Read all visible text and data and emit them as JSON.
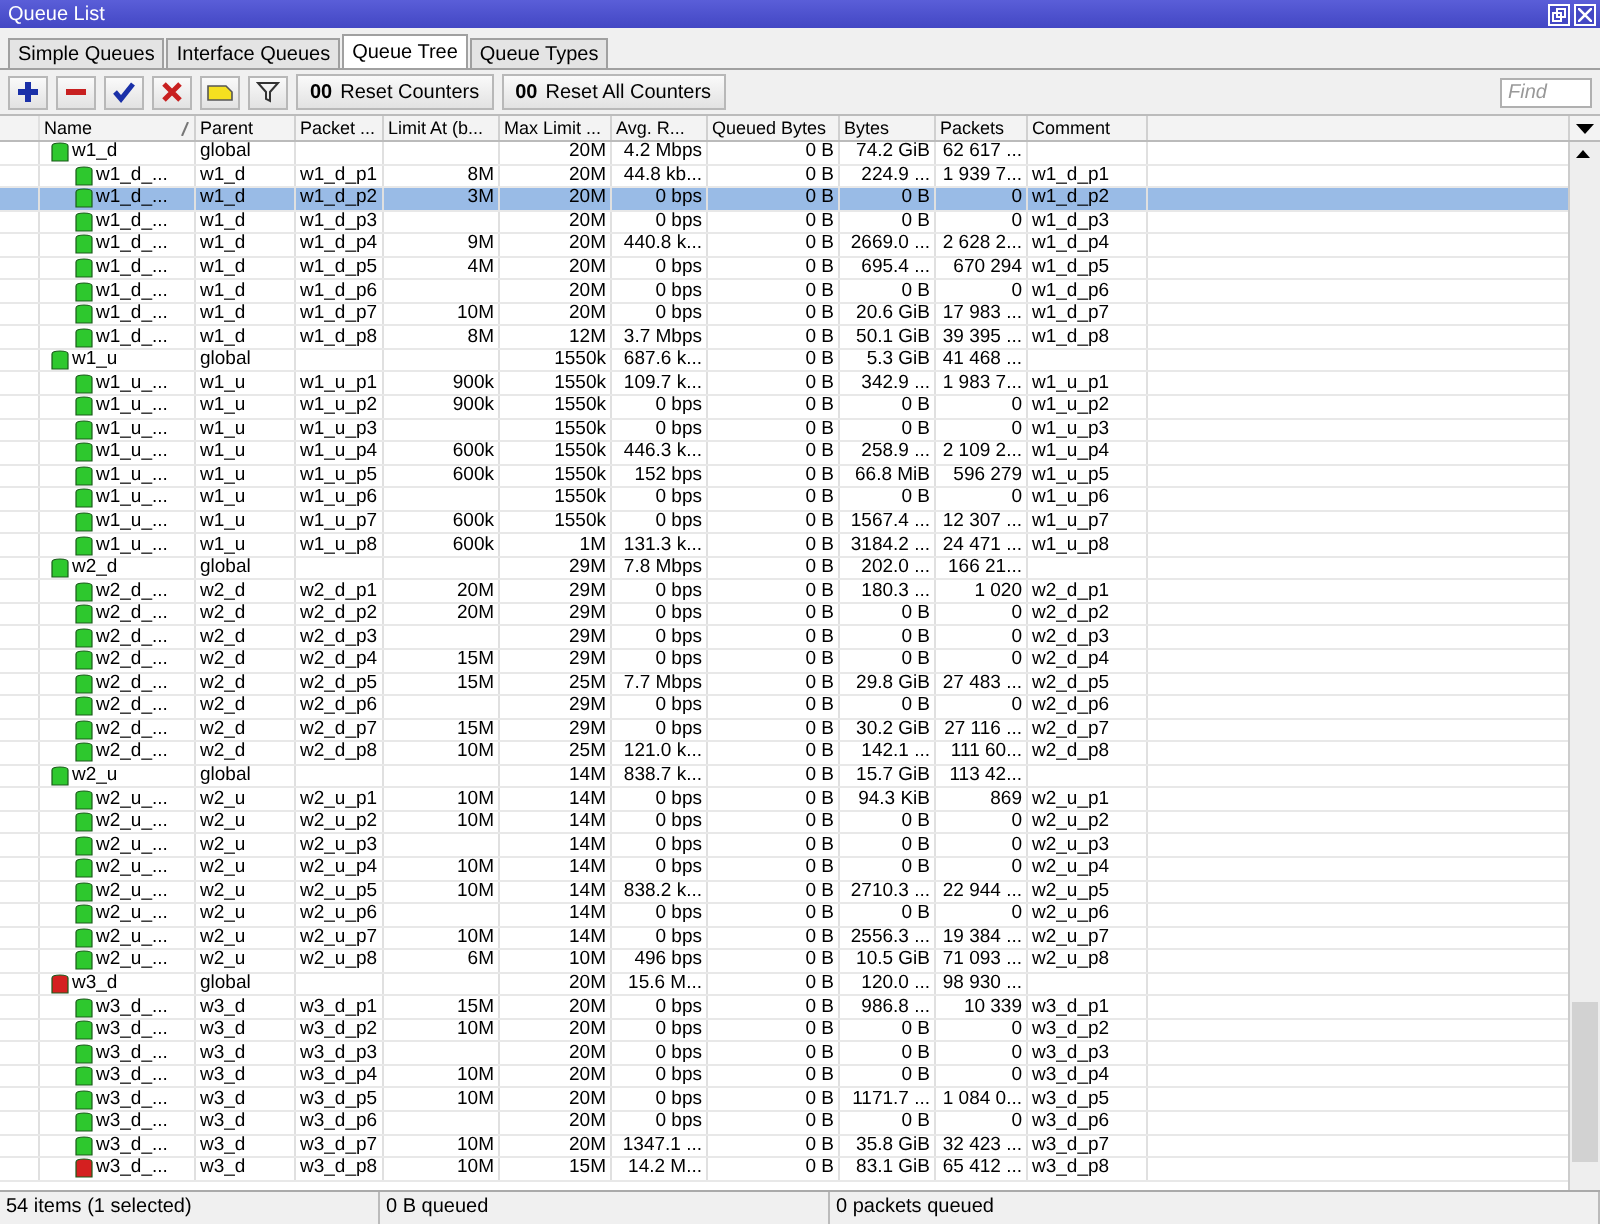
{
  "window": {
    "title": "Queue List"
  },
  "tabs": [
    {
      "label": "Simple Queues",
      "selected": false
    },
    {
      "label": "Interface Queues",
      "selected": false
    },
    {
      "label": "Queue Tree",
      "selected": true
    },
    {
      "label": "Queue Types",
      "selected": false
    }
  ],
  "toolbar": {
    "counter_buttons": [
      {
        "icon_text": "00",
        "label": "Reset Counters"
      },
      {
        "icon_text": "00",
        "label": "Reset All Counters"
      }
    ],
    "search": {
      "placeholder": "Find"
    }
  },
  "table": {
    "columns": [
      "Name",
      "Parent",
      "Packet ...",
      "Limit At (b...",
      "Max Limit ...",
      "Avg. R...",
      "Queued Bytes",
      "Bytes",
      "Packets",
      "Comment"
    ],
    "rows": [
      {
        "name": "w1_d",
        "parent": "global",
        "max_limit": "20M",
        "avg_rate": "4.2 Mbps",
        "queued_bytes": "0 B",
        "bytes": "74.2 GiB",
        "packets": "62 617 ...",
        "color": "#2ec82e",
        "selected": false,
        "children": [
          {
            "name": "w1_d_...",
            "parent": "w1_d",
            "packet_mark": "w1_d_p1",
            "limit_at": "8M",
            "max_limit": "20M",
            "avg_rate": "44.8 kb...",
            "queued_bytes": "0 B",
            "bytes": "224.9 ...",
            "packets": "1 939 7...",
            "comment": "w1_d_p1",
            "color": "#2ec82e",
            "selected": false
          },
          {
            "name": "w1_d_...",
            "parent": "w1_d",
            "packet_mark": "w1_d_p2",
            "limit_at": "3M",
            "max_limit": "20M",
            "avg_rate": "0 bps",
            "queued_bytes": "0 B",
            "bytes": "0 B",
            "packets": "0",
            "comment": "w1_d_p2",
            "color": "#2ec82e",
            "selected": true
          },
          {
            "name": "w1_d_...",
            "parent": "w1_d",
            "packet_mark": "w1_d_p3",
            "max_limit": "20M",
            "avg_rate": "0 bps",
            "queued_bytes": "0 B",
            "bytes": "0 B",
            "packets": "0",
            "comment": "w1_d_p3",
            "color": "#2ec82e",
            "selected": false
          },
          {
            "name": "w1_d_...",
            "parent": "w1_d",
            "packet_mark": "w1_d_p4",
            "limit_at": "9M",
            "max_limit": "20M",
            "avg_rate": "440.8 k...",
            "queued_bytes": "0 B",
            "bytes": "2669.0 ...",
            "packets": "2 628 2...",
            "comment": "w1_d_p4",
            "color": "#2ec82e",
            "selected": false
          },
          {
            "name": "w1_d_...",
            "parent": "w1_d",
            "packet_mark": "w1_d_p5",
            "limit_at": "4M",
            "max_limit": "20M",
            "avg_rate": "0 bps",
            "queued_bytes": "0 B",
            "bytes": "695.4 ...",
            "packets": "670 294",
            "comment": "w1_d_p5",
            "color": "#2ec82e",
            "selected": false
          },
          {
            "name": "w1_d_...",
            "parent": "w1_d",
            "packet_mark": "w1_d_p6",
            "max_limit": "20M",
            "avg_rate": "0 bps",
            "queued_bytes": "0 B",
            "bytes": "0 B",
            "packets": "0",
            "comment": "w1_d_p6",
            "color": "#2ec82e",
            "selected": false
          },
          {
            "name": "w1_d_...",
            "parent": "w1_d",
            "packet_mark": "w1_d_p7",
            "limit_at": "10M",
            "max_limit": "20M",
            "avg_rate": "0 bps",
            "queued_bytes": "0 B",
            "bytes": "20.6 GiB",
            "packets": "17 983 ...",
            "comment": "w1_d_p7",
            "color": "#2ec82e",
            "selected": false
          },
          {
            "name": "w1_d_...",
            "parent": "w1_d",
            "packet_mark": "w1_d_p8",
            "limit_at": "8M",
            "max_limit": "12M",
            "avg_rate": "3.7 Mbps",
            "queued_bytes": "0 B",
            "bytes": "50.1 GiB",
            "packets": "39 395 ...",
            "comment": "w1_d_p8",
            "color": "#2ec82e",
            "selected": false
          }
        ]
      },
      {
        "name": "w1_u",
        "parent": "global",
        "max_limit": "1550k",
        "avg_rate": "687.6 k...",
        "queued_bytes": "0 B",
        "bytes": "5.3 GiB",
        "packets": "41 468 ...",
        "color": "#2ec82e",
        "selected": false,
        "children": [
          {
            "name": "w1_u_...",
            "parent": "w1_u",
            "packet_mark": "w1_u_p1",
            "limit_at": "900k",
            "max_limit": "1550k",
            "avg_rate": "109.7 k...",
            "queued_bytes": "0 B",
            "bytes": "342.9 ...",
            "packets": "1 983 7...",
            "comment": "w1_u_p1",
            "color": "#2ec82e",
            "selected": false
          },
          {
            "name": "w1_u_...",
            "parent": "w1_u",
            "packet_mark": "w1_u_p2",
            "limit_at": "900k",
            "max_limit": "1550k",
            "avg_rate": "0 bps",
            "queued_bytes": "0 B",
            "bytes": "0 B",
            "packets": "0",
            "comment": "w1_u_p2",
            "color": "#2ec82e",
            "selected": false
          },
          {
            "name": "w1_u_...",
            "parent": "w1_u",
            "packet_mark": "w1_u_p3",
            "max_limit": "1550k",
            "avg_rate": "0 bps",
            "queued_bytes": "0 B",
            "bytes": "0 B",
            "packets": "0",
            "comment": "w1_u_p3",
            "color": "#2ec82e",
            "selected": false
          },
          {
            "name": "w1_u_...",
            "parent": "w1_u",
            "packet_mark": "w1_u_p4",
            "limit_at": "600k",
            "max_limit": "1550k",
            "avg_rate": "446.3 k...",
            "queued_bytes": "0 B",
            "bytes": "258.9 ...",
            "packets": "2 109 2...",
            "comment": "w1_u_p4",
            "color": "#2ec82e",
            "selected": false
          },
          {
            "name": "w1_u_...",
            "parent": "w1_u",
            "packet_mark": "w1_u_p5",
            "limit_at": "600k",
            "max_limit": "1550k",
            "avg_rate": "152 bps",
            "queued_bytes": "0 B",
            "bytes": "66.8 MiB",
            "packets": "596 279",
            "comment": "w1_u_p5",
            "color": "#2ec82e",
            "selected": false
          },
          {
            "name": "w1_u_...",
            "parent": "w1_u",
            "packet_mark": "w1_u_p6",
            "max_limit": "1550k",
            "avg_rate": "0 bps",
            "queued_bytes": "0 B",
            "bytes": "0 B",
            "packets": "0",
            "comment": "w1_u_p6",
            "color": "#2ec82e",
            "selected": false
          },
          {
            "name": "w1_u_...",
            "parent": "w1_u",
            "packet_mark": "w1_u_p7",
            "limit_at": "600k",
            "max_limit": "1550k",
            "avg_rate": "0 bps",
            "queued_bytes": "0 B",
            "bytes": "1567.4 ...",
            "packets": "12 307 ...",
            "comment": "w1_u_p7",
            "color": "#2ec82e",
            "selected": false
          },
          {
            "name": "w1_u_...",
            "parent": "w1_u",
            "packet_mark": "w1_u_p8",
            "limit_at": "600k",
            "max_limit": "1M",
            "avg_rate": "131.3 k...",
            "queued_bytes": "0 B",
            "bytes": "3184.2 ...",
            "packets": "24 471 ...",
            "comment": "w1_u_p8",
            "color": "#2ec82e",
            "selected": false
          }
        ]
      },
      {
        "name": "w2_d",
        "parent": "global",
        "max_limit": "29M",
        "avg_rate": "7.8 Mbps",
        "queued_bytes": "0 B",
        "bytes": "202.0 ...",
        "packets": "166 21...",
        "color": "#2ec82e",
        "selected": false,
        "children": [
          {
            "name": "w2_d_...",
            "parent": "w2_d",
            "packet_mark": "w2_d_p1",
            "limit_at": "20M",
            "max_limit": "29M",
            "avg_rate": "0 bps",
            "queued_bytes": "0 B",
            "bytes": "180.3 ...",
            "packets": "1 020",
            "comment": "w2_d_p1",
            "color": "#2ec82e",
            "selected": false
          },
          {
            "name": "w2_d_...",
            "parent": "w2_d",
            "packet_mark": "w2_d_p2",
            "limit_at": "20M",
            "max_limit": "29M",
            "avg_rate": "0 bps",
            "queued_bytes": "0 B",
            "bytes": "0 B",
            "packets": "0",
            "comment": "w2_d_p2",
            "color": "#2ec82e",
            "selected": false
          },
          {
            "name": "w2_d_...",
            "parent": "w2_d",
            "packet_mark": "w2_d_p3",
            "max_limit": "29M",
            "avg_rate": "0 bps",
            "queued_bytes": "0 B",
            "bytes": "0 B",
            "packets": "0",
            "comment": "w2_d_p3",
            "color": "#2ec82e",
            "selected": false
          },
          {
            "name": "w2_d_...",
            "parent": "w2_d",
            "packet_mark": "w2_d_p4",
            "limit_at": "15M",
            "max_limit": "29M",
            "avg_rate": "0 bps",
            "queued_bytes": "0 B",
            "bytes": "0 B",
            "packets": "0",
            "comment": "w2_d_p4",
            "color": "#2ec82e",
            "selected": false
          },
          {
            "name": "w2_d_...",
            "parent": "w2_d",
            "packet_mark": "w2_d_p5",
            "limit_at": "15M",
            "max_limit": "25M",
            "avg_rate": "7.7 Mbps",
            "queued_bytes": "0 B",
            "bytes": "29.8 GiB",
            "packets": "27 483 ...",
            "comment": "w2_d_p5",
            "color": "#2ec82e",
            "selected": false
          },
          {
            "name": "w2_d_...",
            "parent": "w2_d",
            "packet_mark": "w2_d_p6",
            "max_limit": "29M",
            "avg_rate": "0 bps",
            "queued_bytes": "0 B",
            "bytes": "0 B",
            "packets": "0",
            "comment": "w2_d_p6",
            "color": "#2ec82e",
            "selected": false
          },
          {
            "name": "w2_d_...",
            "parent": "w2_d",
            "packet_mark": "w2_d_p7",
            "limit_at": "15M",
            "max_limit": "29M",
            "avg_rate": "0 bps",
            "queued_bytes": "0 B",
            "bytes": "30.2 GiB",
            "packets": "27 116 ...",
            "comment": "w2_d_p7",
            "color": "#2ec82e",
            "selected": false
          },
          {
            "name": "w2_d_...",
            "parent": "w2_d",
            "packet_mark": "w2_d_p8",
            "limit_at": "10M",
            "max_limit": "25M",
            "avg_rate": "121.0 k...",
            "queued_bytes": "0 B",
            "bytes": "142.1 ...",
            "packets": "111 60...",
            "comment": "w2_d_p8",
            "color": "#2ec82e",
            "selected": false
          }
        ]
      },
      {
        "name": "w2_u",
        "parent": "global",
        "max_limit": "14M",
        "avg_rate": "838.7 k...",
        "queued_bytes": "0 B",
        "bytes": "15.7 GiB",
        "packets": "113 42...",
        "color": "#2ec82e",
        "selected": false,
        "children": [
          {
            "name": "w2_u_...",
            "parent": "w2_u",
            "packet_mark": "w2_u_p1",
            "limit_at": "10M",
            "max_limit": "14M",
            "avg_rate": "0 bps",
            "queued_bytes": "0 B",
            "bytes": "94.3 KiB",
            "packets": "869",
            "comment": "w2_u_p1",
            "color": "#2ec82e",
            "selected": false
          },
          {
            "name": "w2_u_...",
            "parent": "w2_u",
            "packet_mark": "w2_u_p2",
            "limit_at": "10M",
            "max_limit": "14M",
            "avg_rate": "0 bps",
            "queued_bytes": "0 B",
            "bytes": "0 B",
            "packets": "0",
            "comment": "w2_u_p2",
            "color": "#2ec82e",
            "selected": false
          },
          {
            "name": "w2_u_...",
            "parent": "w2_u",
            "packet_mark": "w2_u_p3",
            "max_limit": "14M",
            "avg_rate": "0 bps",
            "queued_bytes": "0 B",
            "bytes": "0 B",
            "packets": "0",
            "comment": "w2_u_p3",
            "color": "#2ec82e",
            "selected": false
          },
          {
            "name": "w2_u_...",
            "parent": "w2_u",
            "packet_mark": "w2_u_p4",
            "limit_at": "10M",
            "max_limit": "14M",
            "avg_rate": "0 bps",
            "queued_bytes": "0 B",
            "bytes": "0 B",
            "packets": "0",
            "comment": "w2_u_p4",
            "color": "#2ec82e",
            "selected": false
          },
          {
            "name": "w2_u_...",
            "parent": "w2_u",
            "packet_mark": "w2_u_p5",
            "limit_at": "10M",
            "max_limit": "14M",
            "avg_rate": "838.2 k...",
            "queued_bytes": "0 B",
            "bytes": "2710.3 ...",
            "packets": "22 944 ...",
            "comment": "w2_u_p5",
            "color": "#2ec82e",
            "selected": false
          },
          {
            "name": "w2_u_...",
            "parent": "w2_u",
            "packet_mark": "w2_u_p6",
            "max_limit": "14M",
            "avg_rate": "0 bps",
            "queued_bytes": "0 B",
            "bytes": "0 B",
            "packets": "0",
            "comment": "w2_u_p6",
            "color": "#2ec82e",
            "selected": false
          },
          {
            "name": "w2_u_...",
            "parent": "w2_u",
            "packet_mark": "w2_u_p7",
            "limit_at": "10M",
            "max_limit": "14M",
            "avg_rate": "0 bps",
            "queued_bytes": "0 B",
            "bytes": "2556.3 ...",
            "packets": "19 384 ...",
            "comment": "w2_u_p7",
            "color": "#2ec82e",
            "selected": false
          },
          {
            "name": "w2_u_...",
            "parent": "w2_u",
            "packet_mark": "w2_u_p8",
            "limit_at": "6M",
            "max_limit": "10M",
            "avg_rate": "496 bps",
            "queued_bytes": "0 B",
            "bytes": "10.5 GiB",
            "packets": "71 093 ...",
            "comment": "w2_u_p8",
            "color": "#2ec82e",
            "selected": false
          }
        ]
      },
      {
        "name": "w3_d",
        "parent": "global",
        "max_limit": "20M",
        "avg_rate": "15.6 M...",
        "queued_bytes": "0 B",
        "bytes": "120.0 ...",
        "packets": "98 930 ...",
        "color": "#d42020",
        "selected": false,
        "children": [
          {
            "name": "w3_d_...",
            "parent": "w3_d",
            "packet_mark": "w3_d_p1",
            "limit_at": "15M",
            "max_limit": "20M",
            "avg_rate": "0 bps",
            "queued_bytes": "0 B",
            "bytes": "986.8 ...",
            "packets": "10 339",
            "comment": "w3_d_p1",
            "color": "#2ec82e",
            "selected": false
          },
          {
            "name": "w3_d_...",
            "parent": "w3_d",
            "packet_mark": "w3_d_p2",
            "limit_at": "10M",
            "max_limit": "20M",
            "avg_rate": "0 bps",
            "queued_bytes": "0 B",
            "bytes": "0 B",
            "packets": "0",
            "comment": "w3_d_p2",
            "color": "#2ec82e",
            "selected": false
          },
          {
            "name": "w3_d_...",
            "parent": "w3_d",
            "packet_mark": "w3_d_p3",
            "max_limit": "20M",
            "avg_rate": "0 bps",
            "queued_bytes": "0 B",
            "bytes": "0 B",
            "packets": "0",
            "comment": "w3_d_p3",
            "color": "#2ec82e",
            "selected": false
          },
          {
            "name": "w3_d_...",
            "parent": "w3_d",
            "packet_mark": "w3_d_p4",
            "limit_at": "10M",
            "max_limit": "20M",
            "avg_rate": "0 bps",
            "queued_bytes": "0 B",
            "bytes": "0 B",
            "packets": "0",
            "comment": "w3_d_p4",
            "color": "#2ec82e",
            "selected": false
          },
          {
            "name": "w3_d_...",
            "parent": "w3_d",
            "packet_mark": "w3_d_p5",
            "limit_at": "10M",
            "max_limit": "20M",
            "avg_rate": "0 bps",
            "queued_bytes": "0 B",
            "bytes": "1171.7 ...",
            "packets": "1 084 0...",
            "comment": "w3_d_p5",
            "color": "#2ec82e",
            "selected": false
          },
          {
            "name": "w3_d_...",
            "parent": "w3_d",
            "packet_mark": "w3_d_p6",
            "max_limit": "20M",
            "avg_rate": "0 bps",
            "queued_bytes": "0 B",
            "bytes": "0 B",
            "packets": "0",
            "comment": "w3_d_p6",
            "color": "#2ec82e",
            "selected": false
          },
          {
            "name": "w3_d_...",
            "parent": "w3_d",
            "packet_mark": "w3_d_p7",
            "limit_at": "10M",
            "max_limit": "20M",
            "avg_rate": "1347.1 ...",
            "queued_bytes": "0 B",
            "bytes": "35.8 GiB",
            "packets": "32 423 ...",
            "comment": "w3_d_p7",
            "color": "#2ec82e",
            "selected": false
          },
          {
            "name": "w3_d_...",
            "parent": "w3_d",
            "packet_mark": "w3_d_p8",
            "limit_at": "10M",
            "max_limit": "15M",
            "avg_rate": "14.2 M...",
            "queued_bytes": "0 B",
            "bytes": "83.1 GiB",
            "packets": "65 412 ...",
            "comment": "w3_d_p8",
            "color": "#d42020",
            "selected": false
          }
        ]
      }
    ]
  },
  "status_bar": [
    "54 items (1 selected)",
    "0 B queued",
    "0 packets queued"
  ]
}
